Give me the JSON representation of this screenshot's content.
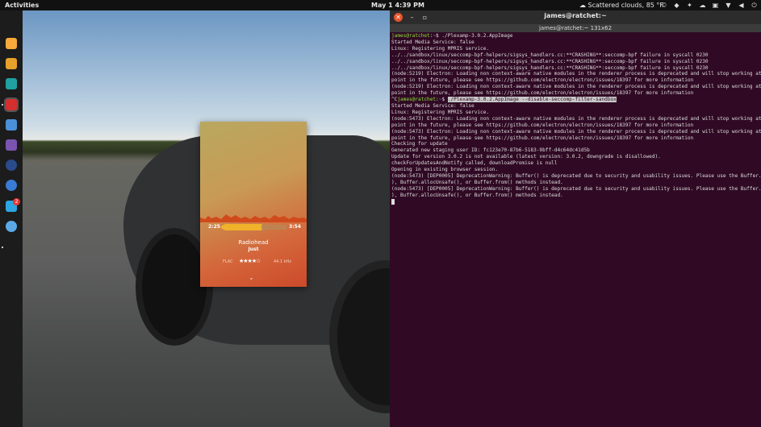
{
  "topbar": {
    "activities": "Activities",
    "clock": "May 1   4:39 PM",
    "weather": "Scattered clouds, 85 °F",
    "tray_icons": [
      "weather-icon",
      "copyright-icon",
      "app-indicator-icon",
      "dropbox-icon",
      "cloud-icon",
      "app-indicator-icon",
      "network-icon",
      "volume-icon",
      "power-icon"
    ]
  },
  "dock": {
    "apps": [
      {
        "name": "brave-browser",
        "color": "#f7a93c"
      },
      {
        "name": "files",
        "color": "#e6a02b"
      },
      {
        "name": "software-store",
        "color": "#21a0a0"
      },
      {
        "name": "plexamp",
        "color": "#d32f2f"
      },
      {
        "name": "text-editor",
        "color": "#4a90d9"
      },
      {
        "name": "document-viewer",
        "color": "#7a54b0"
      },
      {
        "name": "mkv-tool",
        "color": "#2a4b8c"
      },
      {
        "name": "settings",
        "color": "#3a7bd5"
      },
      {
        "name": "telegram",
        "color": "#2ca5e0"
      },
      {
        "name": "messenger",
        "color": "#5aa9e6"
      }
    ],
    "badge": "2"
  },
  "player": {
    "time_current": "2:25",
    "time_total": "3:54",
    "artist": "Radiohead",
    "track": "Just",
    "format": "FLAC",
    "stars": "★★★★☆",
    "sample_rate": "44.1 kHz",
    "progress": 0.62,
    "chevron": "⌄"
  },
  "terminal": {
    "title": "james@ratchet:~",
    "tab": "james@ratchet:~ 131x62",
    "lines": [
      {
        "prompt": "james@ratchet",
        "path": "~",
        "cmd": "$ ./Plexamp-3.0.2.AppImage"
      },
      {
        "text": "Started Media Service: false"
      },
      {
        "text": "Linux: Registering MPRIS service."
      },
      {
        "text": "../../sandbox/linux/seccomp-bpf-helpers/sigsys_handlers.cc:**CRASHING**:seccomp-bpf failure in syscall 0230"
      },
      {
        "text": "../../sandbox/linux/seccomp-bpf-helpers/sigsys_handlers.cc:**CRASHING**:seccomp-bpf failure in syscall 0230"
      },
      {
        "text": "../../sandbox/linux/seccomp-bpf-helpers/sigsys_handlers.cc:**CRASHING**:seccomp-bpf failure in syscall 0230"
      },
      {
        "text": "(node:5219) Electron: Loading non context-aware native modules in the renderer process is deprecated and will stop working at some"
      },
      {
        "text": "point in the future, please see https://github.com/electron/electron/issues/18397 for more information"
      },
      {
        "text": "(node:5219) Electron: Loading non context-aware native modules in the renderer process is deprecated and will stop working at some"
      },
      {
        "text": "point in the future, please see https://github.com/electron/electron/issues/18397 for more information"
      },
      {
        "prefix": "^C",
        "prompt": "james@ratchet",
        "path": "~",
        "cmd": "$ ",
        "sel": "./Plexamp-3.0.2.AppImage --disable-seccomp-filter-sandbox"
      },
      {
        "text": "Started Media Service: false"
      },
      {
        "text": "Linux: Registering MPRIS service."
      },
      {
        "text": "(node:5473) Electron: Loading non context-aware native modules in the renderer process is deprecated and will stop working at some"
      },
      {
        "text": "point in the future, please see https://github.com/electron/electron/issues/18397 for more information"
      },
      {
        "text": "(node:5473) Electron: Loading non context-aware native modules in the renderer process is deprecated and will stop working at some"
      },
      {
        "text": "point in the future, please see https://github.com/electron/electron/issues/18397 for more information"
      },
      {
        "text": "Checking for update"
      },
      {
        "text": "Generated new staging user ID: fc123e70-87b6-5183-9bff-d4c64dc41d5b"
      },
      {
        "text": "Update for version 3.0.2 is not available (latest version: 3.0.2, downgrade is disallowed)."
      },
      {
        "text": "checkForUpdatesAndNotify called, downloadPromise is null"
      },
      {
        "text": "Opening in existing browser session."
      },
      {
        "text": "(node:5473) [DEP0005] DeprecationWarning: Buffer() is deprecated due to security and usability issues. Please use the Buffer.alloc("
      },
      {
        "text": "), Buffer.allocUnsafe(), or Buffer.from() methods instead."
      },
      {
        "text": "(node:5473) [DEP0005] DeprecationWarning: Buffer() is deprecated due to security and usability issues. Please use the Buffer.alloc("
      },
      {
        "text": "), Buffer.allocUnsafe(), or Buffer.from() methods instead."
      }
    ]
  }
}
